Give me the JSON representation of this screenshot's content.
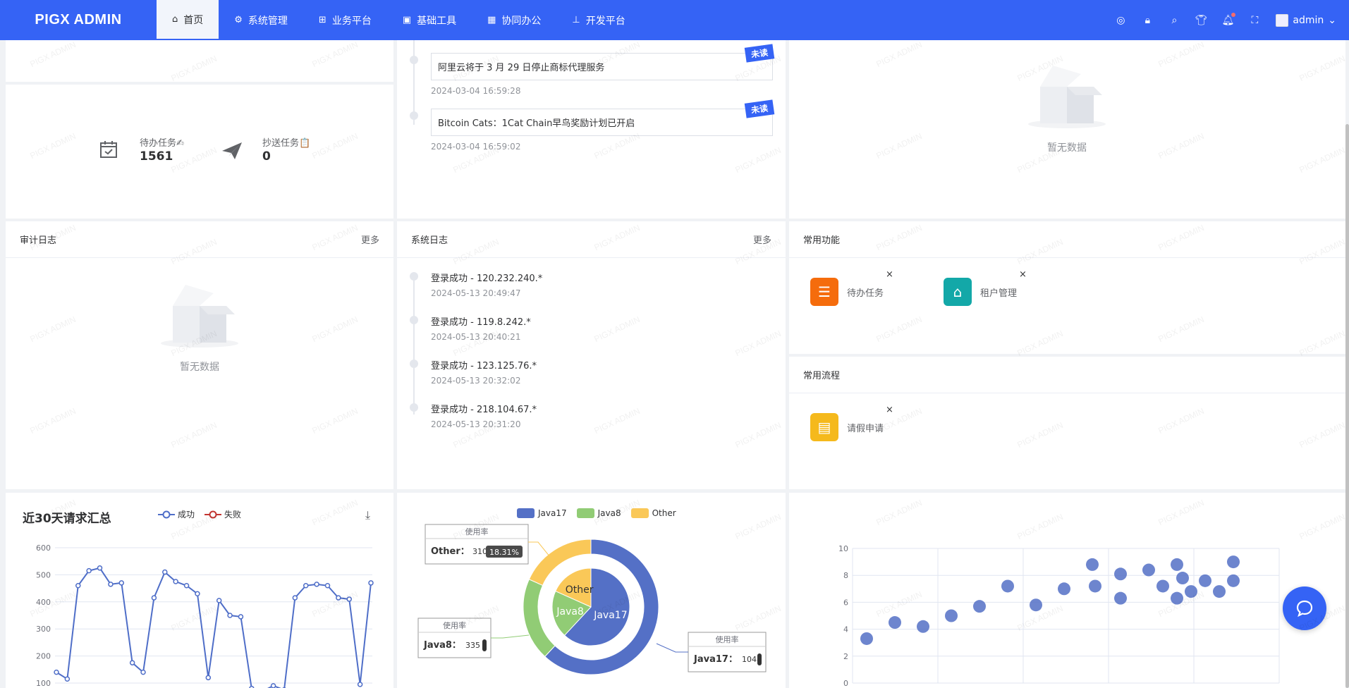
{
  "app": {
    "logo": "PIGX ADMIN"
  },
  "menu": [
    {
      "label": "首页",
      "icon": "home-icon",
      "active": true
    },
    {
      "label": "系统管理",
      "icon": "gear-icon"
    },
    {
      "label": "业务平台",
      "icon": "grid-icon"
    },
    {
      "label": "基础工具",
      "icon": "toolbox-icon"
    },
    {
      "label": "协同办公",
      "icon": "building-icon"
    },
    {
      "label": "开发平台",
      "icon": "sitemap-icon"
    }
  ],
  "user": {
    "name": "admin"
  },
  "tasks": {
    "todo_label": "待办任务✍",
    "todo_value": "1561",
    "cc_label": "抄送任务📋",
    "cc_value": "0"
  },
  "notices": [
    {
      "title": "阿里云将于 3 月 29 日停止商标代理服务",
      "time": "2024-03-04 16:59:28",
      "badge": "未读"
    },
    {
      "title": "Bitcoin Cats：1Cat Chain早鸟奖励计划已开启",
      "time": "2024-03-04 16:59:02",
      "badge": "未读"
    }
  ],
  "empty_text": "暂无数据",
  "audit": {
    "title": "审计日志",
    "more": "更多",
    "empty": "暂无数据"
  },
  "syslog": {
    "title": "系统日志",
    "more": "更多",
    "items": [
      {
        "title": "登录成功 - 120.232.240.*",
        "time": "2024-05-13 20:49:47"
      },
      {
        "title": "登录成功 - 119.8.242.*",
        "time": "2024-05-13 20:40:21"
      },
      {
        "title": "登录成功 - 123.125.76.*",
        "time": "2024-05-13 20:32:02"
      },
      {
        "title": "登录成功 - 218.104.67.*",
        "time": "2024-05-13 20:31:20"
      }
    ]
  },
  "common_functions": {
    "title": "常用功能",
    "items": [
      {
        "label": "待办任务",
        "icon": "list-icon",
        "color": "#f56c0c"
      },
      {
        "label": "租户管理",
        "icon": "house-icon",
        "color": "#13a8a8"
      }
    ]
  },
  "common_flows": {
    "title": "常用流程",
    "items": [
      {
        "label": "请假申请",
        "icon": "contact-book-icon",
        "color": "#f5b91c"
      }
    ]
  },
  "watermark": "PIGX ADMIN",
  "chart_data": [
    {
      "type": "line",
      "title": "近30天请求汇总",
      "legend": [
        "成功",
        "失败"
      ],
      "legend_placement": "top",
      "ylim": [
        100,
        600
      ],
      "yticks": [
        100,
        200,
        300,
        400,
        500,
        600
      ],
      "series": [
        {
          "name": "成功",
          "color": "#4f6ec8",
          "values": [
            140,
            115,
            460,
            515,
            525,
            465,
            470,
            175,
            140,
            415,
            510,
            475,
            460,
            430,
            120,
            405,
            350,
            345,
            80,
            70,
            90,
            75,
            415,
            460,
            465,
            460,
            415,
            410,
            95,
            470
          ]
        },
        {
          "name": "失败",
          "color": "#c23531",
          "values": []
        }
      ]
    },
    {
      "type": "pie",
      "legend": [
        "Java17",
        "Java8",
        "Other"
      ],
      "legend_placement": "top",
      "slices": [
        {
          "name": "Java17",
          "value": 1048,
          "color": "#5470c6"
        },
        {
          "name": "Java8",
          "value": 335,
          "color": "#91cc75"
        },
        {
          "name": "Other",
          "value": 310,
          "color": "#fac858"
        }
      ],
      "tooltip_title": "使用率",
      "other_percent": "18.31%"
    },
    {
      "type": "scatter",
      "ylim": [
        0,
        10
      ],
      "yticks": [
        0,
        2,
        4,
        6,
        8,
        10
      ],
      "color": "#5470c6",
      "points": [
        [
          1,
          3.3
        ],
        [
          2,
          4.5
        ],
        [
          3,
          4.2
        ],
        [
          4,
          5.0
        ],
        [
          5,
          5.7
        ],
        [
          6,
          7.2
        ],
        [
          7,
          5.8
        ],
        [
          8,
          7.0
        ],
        [
          9,
          8.8
        ],
        [
          9.1,
          7.2
        ],
        [
          10,
          8.1
        ],
        [
          10,
          6.3
        ],
        [
          11,
          8.4
        ],
        [
          11.5,
          7.2
        ],
        [
          12,
          8.8
        ],
        [
          12,
          6.3
        ],
        [
          12.2,
          7.8
        ],
        [
          12.5,
          6.8
        ],
        [
          13,
          7.6
        ],
        [
          13.5,
          6.8
        ],
        [
          14,
          9.0
        ],
        [
          14,
          7.6
        ]
      ]
    }
  ]
}
